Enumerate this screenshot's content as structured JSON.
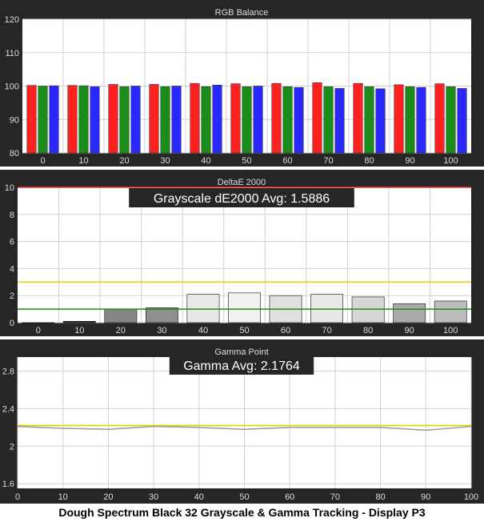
{
  "caption": "Dough Spectrum Black 32 Grayscale & Gamma Tracking - Display P3",
  "colors": {
    "panel_bg": "#262626",
    "plot_bg": "#ffffff",
    "red": "#ff2020",
    "green": "#1a8c1a",
    "blue": "#2828ff",
    "gamma_target": "#e6d200",
    "gamma_measured": "#9a9a9a",
    "threshold_red": "#ff3030",
    "threshold_yellow": "#e6d200",
    "threshold_green": "#1a8c1a"
  },
  "chart_data": [
    {
      "type": "bar",
      "title": "RGB Balance",
      "categories": [
        "0",
        "10",
        "20",
        "30",
        "40",
        "50",
        "60",
        "70",
        "80",
        "90",
        "100"
      ],
      "series": [
        {
          "color": "red",
          "values": [
            100.2,
            100.2,
            100.5,
            100.5,
            100.8,
            100.7,
            100.8,
            101.0,
            100.8,
            100.4,
            100.7
          ]
        },
        {
          "color": "green",
          "values": [
            100.0,
            100.1,
            99.8,
            99.8,
            99.8,
            99.8,
            99.8,
            99.8,
            99.8,
            99.8,
            99.8
          ]
        },
        {
          "color": "blue",
          "values": [
            100.1,
            99.8,
            100.0,
            100.0,
            100.3,
            100.0,
            99.6,
            99.3,
            99.2,
            99.6,
            99.3
          ]
        }
      ],
      "ylim": [
        80,
        120
      ],
      "yticks": [
        "80",
        "90",
        "100",
        "110",
        "120"
      ],
      "grid": true
    },
    {
      "type": "bar",
      "title": "DeltaE 2000",
      "annotation": "Grayscale dE2000 Avg: 1.5886",
      "categories": [
        "0",
        "10",
        "20",
        "30",
        "40",
        "50",
        "60",
        "70",
        "80",
        "90",
        "100"
      ],
      "series": [
        {
          "values": [
            0.0,
            0.1,
            1.0,
            1.1,
            2.1,
            2.2,
            2.0,
            2.1,
            1.9,
            1.4,
            1.6
          ]
        }
      ],
      "thresholds": [
        {
          "value": 10,
          "color": "red"
        },
        {
          "value": 3,
          "color": "yellow"
        },
        {
          "value": 1,
          "color": "green"
        }
      ],
      "ylim": [
        0,
        10
      ],
      "yticks": [
        "0",
        "2",
        "4",
        "6",
        "8",
        "10"
      ],
      "grid": true
    },
    {
      "type": "line",
      "title": "Gamma Point",
      "annotation": "Gamma Avg: 2.1764",
      "x": [
        0,
        10,
        20,
        30,
        40,
        50,
        60,
        70,
        80,
        90,
        100
      ],
      "xticks": [
        "0",
        "10",
        "20",
        "30",
        "40",
        "50",
        "60",
        "70",
        "80",
        "90",
        "100"
      ],
      "series": [
        {
          "color": "target",
          "values": [
            2.22,
            2.22,
            2.22,
            2.22,
            2.22,
            2.22,
            2.22,
            2.22,
            2.22,
            2.22,
            2.22
          ]
        },
        {
          "color": "measured",
          "values": [
            2.21,
            2.19,
            2.18,
            2.21,
            2.2,
            2.18,
            2.2,
            2.2,
            2.2,
            2.17,
            2.21
          ]
        }
      ],
      "ylim": [
        1.55,
        2.95
      ],
      "yticks": [
        "1.6",
        "2",
        "2.4",
        "2.8"
      ],
      "grid": true
    }
  ]
}
